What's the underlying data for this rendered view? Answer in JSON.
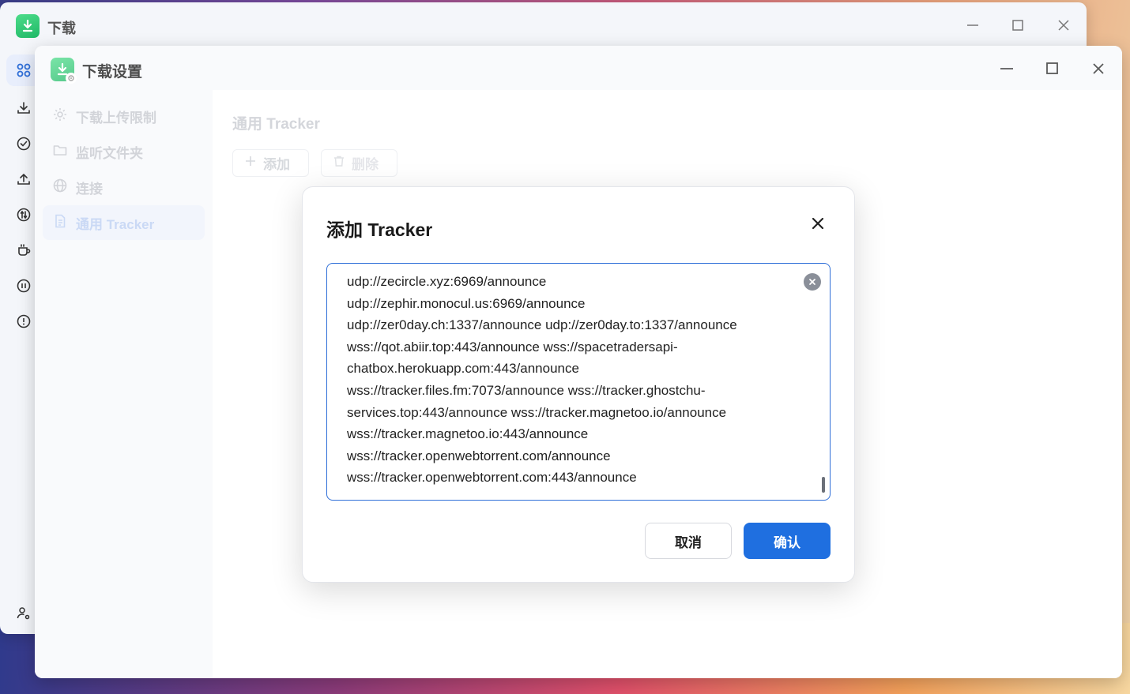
{
  "back_window": {
    "title": "下载",
    "rail_icons": [
      "apps-grid-icon",
      "download-icon",
      "check-circle-icon",
      "upload-icon",
      "speed-icon",
      "cup-icon",
      "pause-circle-icon",
      "alert-circle-icon",
      "user-settings-icon"
    ]
  },
  "settings_window": {
    "title": "下载设置",
    "sidebar": {
      "items": [
        {
          "label": "下载上传限制",
          "icon": "gear-icon"
        },
        {
          "label": "监听文件夹",
          "icon": "folder-icon"
        },
        {
          "label": "连接",
          "icon": "globe-icon"
        },
        {
          "label": "通用 Tracker",
          "icon": "document-icon",
          "active": true
        }
      ]
    },
    "main": {
      "title": "通用 Tracker",
      "add_label": "添加",
      "delete_label": "删除"
    }
  },
  "dialog": {
    "title": "添加 Tracker",
    "textarea_value": "udp://zecircle.xyz:6969/announce\nudp://zephir.monocul.us:6969/announce\nudp://zer0day.ch:1337/announce udp://zer0day.to:1337/announce\nwss://qot.abiir.top:443/announce wss://spacetradersapi-\nchatbox.herokuapp.com:443/announce\nwss://tracker.files.fm:7073/announce wss://tracker.ghostchu-\nservices.top:443/announce wss://tracker.magnetoo.io/announce\nwss://tracker.magnetoo.io:443/announce\nwss://tracker.openwebtorrent.com/announce\nwss://tracker.openwebtorrent.com:443/announce",
    "cancel_label": "取消",
    "confirm_label": "确认"
  },
  "colors": {
    "accent": "#1f6fe0",
    "logo_green": "#27c26f"
  }
}
